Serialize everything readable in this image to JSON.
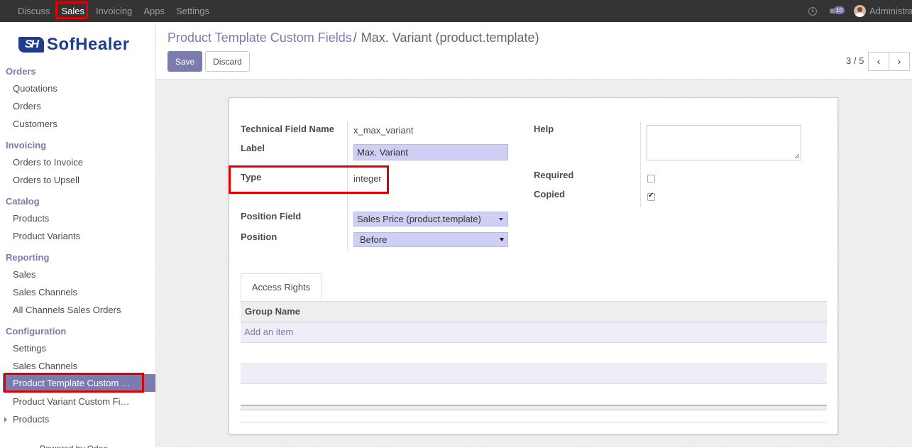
{
  "topbar": {
    "menu": [
      "Discuss",
      "Sales",
      "Invoicing",
      "Apps",
      "Settings"
    ],
    "active": "Sales",
    "message_count": "10",
    "user": "Administrator"
  },
  "sidebar": {
    "logo_text": "SofHealer",
    "logo_mark": "SH",
    "sections": [
      {
        "title": "Orders",
        "items": [
          "Quotations",
          "Orders",
          "Customers"
        ]
      },
      {
        "title": "Invoicing",
        "items": [
          "Orders to Invoice",
          "Orders to Upsell"
        ]
      },
      {
        "title": "Catalog",
        "items": [
          "Products",
          "Product Variants"
        ]
      },
      {
        "title": "Reporting",
        "items": [
          "Sales",
          "Sales Channels",
          "All Channels Sales Orders"
        ]
      },
      {
        "title": "Configuration",
        "items": [
          "Settings",
          "Sales Channels",
          "Product Template Custom …",
          "Product Variant Custom Fi…",
          "Products"
        ]
      }
    ],
    "powered_by": "Powered by Odoo"
  },
  "breadcrumb": {
    "parent": "Product Template Custom Fields",
    "separator": "/",
    "current": "Max. Variant (product.template)"
  },
  "buttons": {
    "save": "Save",
    "discard": "Discard"
  },
  "pager": {
    "value": "3 / 5",
    "prev": "‹",
    "next": "›"
  },
  "form": {
    "technical_field_name": {
      "label": "Technical Field Name",
      "value": "x_max_variant"
    },
    "label_field": {
      "label": "Label",
      "value": "Max. Variant"
    },
    "type": {
      "label": "Type",
      "value": "integer"
    },
    "position_field": {
      "label": "Position Field",
      "value": "Sales Price (product.template)"
    },
    "position": {
      "label": "Position",
      "value": "Before"
    },
    "help": {
      "label": "Help",
      "value": ""
    },
    "required": {
      "label": "Required",
      "checked": false
    },
    "copied": {
      "label": "Copied",
      "checked": true
    }
  },
  "tabs": {
    "access_rights": "Access Rights",
    "column": "Group Name",
    "add_item": "Add an item"
  },
  "colors": {
    "accent": "#7c7bad",
    "highlight": "#e00000",
    "topbar": "#343434"
  }
}
